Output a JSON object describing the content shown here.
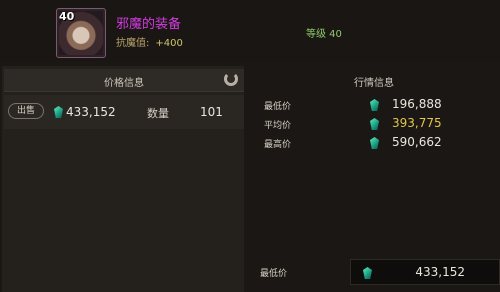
{
  "item": {
    "level_badge": "40",
    "name": "邪魔的装备",
    "stat_label": "抗魔值:",
    "stat_value": "+400",
    "level_req": "等级 40"
  },
  "price_panel": {
    "title": "价格信息",
    "sell_button": "出售",
    "sell_price": "433,152",
    "quantity_label": "数量",
    "quantity_value": "101"
  },
  "market_panel": {
    "title": "行情信息",
    "rows": [
      {
        "label": "最低价",
        "value": "196,888"
      },
      {
        "label": "平均价",
        "value": "393,775"
      },
      {
        "label": "最高价",
        "value": "590,662"
      }
    ]
  },
  "bottom": {
    "label": "最低价",
    "value": "433,152"
  },
  "colors": {
    "item_name": "#d23cdf",
    "level_req": "#8ec86b",
    "avg_price": "#e2c54a",
    "currency_gem": "#2fd1a1"
  },
  "icons": [
    "item-icon",
    "refresh-icon",
    "gem-currency-icon"
  ]
}
